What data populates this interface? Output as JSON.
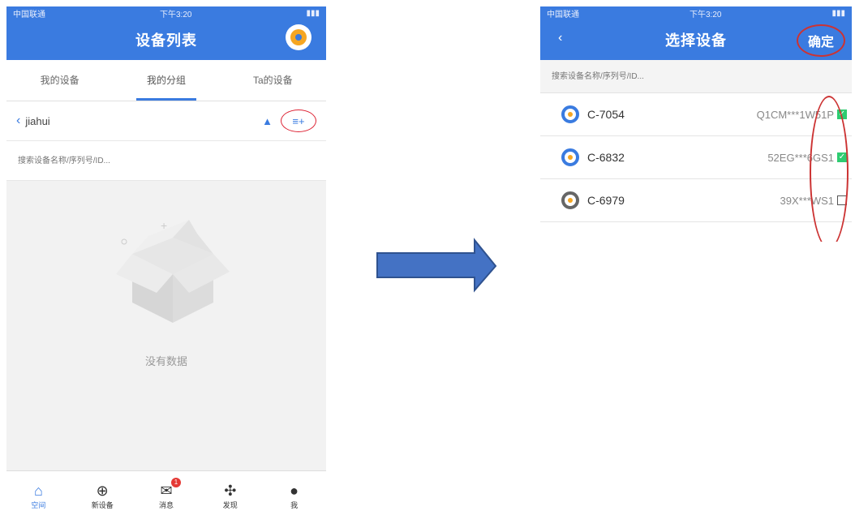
{
  "left": {
    "status": {
      "carrier": "中国联通",
      "time": "下午3:20"
    },
    "title": "设备列表",
    "tabs": [
      {
        "label": "我的设备"
      },
      {
        "label": "我的分组"
      },
      {
        "label": "Ta的设备"
      }
    ],
    "group_name": "jiahui",
    "search_placeholder": "搜索设备名称/序列号/ID...",
    "empty_text": "没有数据",
    "tabbar": [
      {
        "label": "空间",
        "icon": "home-icon"
      },
      {
        "label": "新设备",
        "icon": "plus-circle-icon"
      },
      {
        "label": "消息",
        "icon": "mail-icon",
        "badge": "1"
      },
      {
        "label": "发现",
        "icon": "fan-icon"
      },
      {
        "label": "我",
        "icon": "user-icon"
      }
    ]
  },
  "right": {
    "status": {
      "carrier": "中国联通",
      "time": "下午3:20"
    },
    "title": "选择设备",
    "confirm_label": "确定",
    "search_placeholder": "搜索设备名称/序列号/ID...",
    "devices": [
      {
        "name": "C-7054",
        "serial": "Q1CM***1W51P",
        "checked": true
      },
      {
        "name": "C-6832",
        "serial": "52EG***6GS1",
        "checked": true
      },
      {
        "name": "C-6979",
        "serial": "39X***WS1",
        "checked": false
      }
    ]
  },
  "colors": {
    "accent": "#3a7be0",
    "highlight": "#cc3333",
    "check": "#2ecc71"
  }
}
